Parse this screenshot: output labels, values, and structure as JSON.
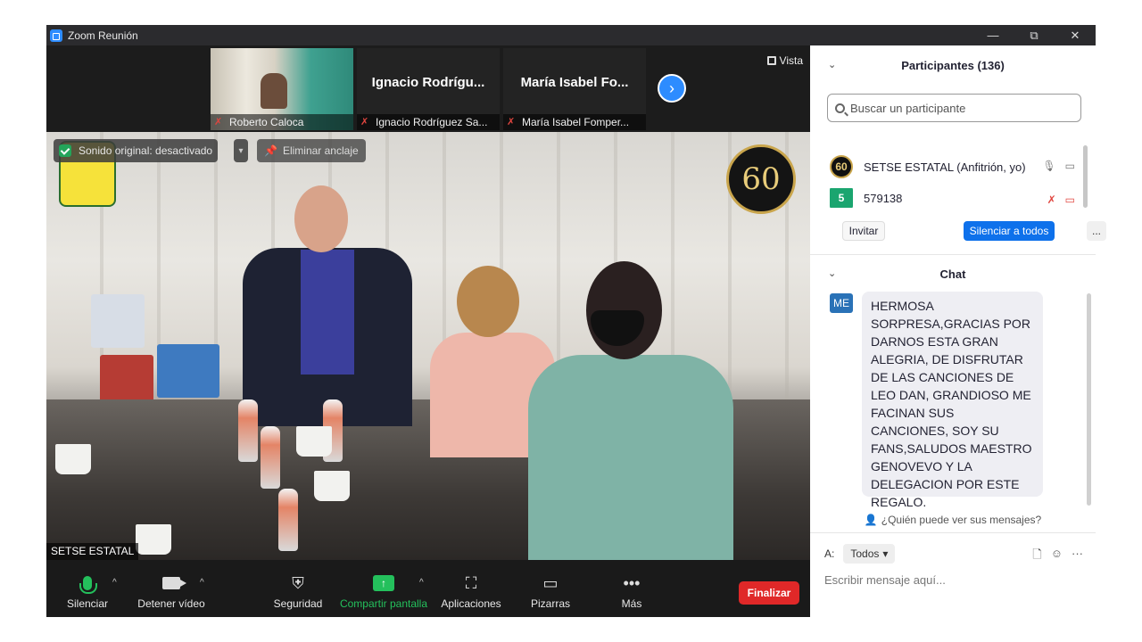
{
  "window": {
    "title": "Zoom Reunión",
    "controls": [
      "—",
      "⧉",
      "✕"
    ]
  },
  "thumbnails": [
    {
      "big": "",
      "name": "Roberto Caloca",
      "has_video": true
    },
    {
      "big": "Ignacio  Rodrígu...",
      "name": "Ignacio Rodríguez Sa...",
      "has_video": false
    },
    {
      "big": "María  Isabel  Fo...",
      "name": "María Isabel Fomper...",
      "has_video": false
    }
  ],
  "view_button": "Vista",
  "main_video": {
    "audio_chip": "Sonido original: desactivado",
    "unpin": "Eliminar anclaje",
    "speaker": "SETSE ESTATAL",
    "logo_text": "60"
  },
  "toolbar": {
    "mute": "Silenciar",
    "video": "Detener vídeo",
    "security": "Seguridad",
    "share": "Compartir pantalla",
    "apps": "Aplicaciones",
    "whiteboards": "Pizarras",
    "more": "Más",
    "end": "Finalizar"
  },
  "participants": {
    "header": "Participantes (136)",
    "search_placeholder": "Buscar un participante",
    "rows": [
      {
        "name": "SETSE ESTATAL (Anfitrión, yo)",
        "avatar": "60",
        "avatar_color": "#111111"
      },
      {
        "name": "579138",
        "avatar": "5",
        "avatar_color": "#1aa56f"
      }
    ],
    "invite": "Invitar",
    "mute_all": "Silenciar a todos",
    "more": "..."
  },
  "chat": {
    "header": "Chat",
    "sender_initials": "ME",
    "message": "HERMOSA SORPRESA,GRACIAS POR DARNOS ESTA GRAN ALEGRIA, DE DISFRUTAR DE LAS CANCIONES DE LEO DAN, GRANDIOSO ME FACINAN SUS CANCIONES, SOY SU FANS,SALUDOS MAESTRO GENOVEVO Y LA DELEGACION POR ESTE REGALO.",
    "who_can_see": "¿Quién puede ver sus mensajes?",
    "to_label": "A:",
    "to_value": "Todos",
    "compose_placeholder": "Escribir mensaje aquí..."
  },
  "colors": {
    "accent": "#2d8cff",
    "green": "#24c05c",
    "end": "#e02828"
  }
}
